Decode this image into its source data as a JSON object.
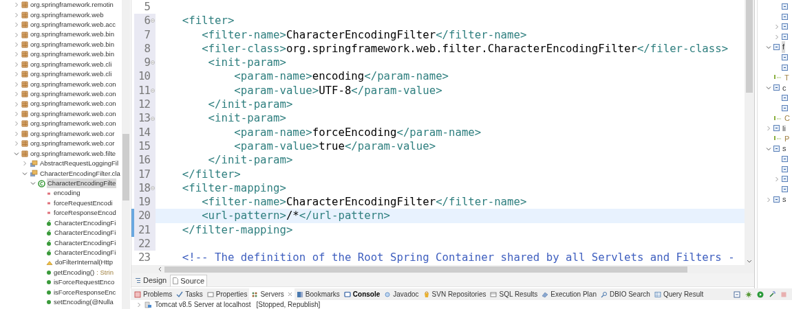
{
  "package_explorer": {
    "items": [
      {
        "name": "org.springframework.remotin",
        "kind": "package",
        "expanded": false,
        "selected": false
      },
      {
        "name": "org.springframework.web",
        "kind": "package",
        "expanded": false,
        "selected": false
      },
      {
        "name": "org.springframework.web.acc",
        "kind": "package",
        "expanded": false,
        "selected": false
      },
      {
        "name": "org.springframework.web.bin",
        "kind": "package",
        "expanded": false,
        "selected": false
      },
      {
        "name": "org.springframework.web.bin",
        "kind": "package",
        "expanded": false,
        "selected": false
      },
      {
        "name": "org.springframework.web.bin",
        "kind": "package",
        "expanded": false,
        "selected": false
      },
      {
        "name": "org.springframework.web.cli",
        "kind": "package",
        "expanded": false,
        "selected": false
      },
      {
        "name": "org.springframework.web.cli",
        "kind": "package",
        "expanded": false,
        "selected": false
      },
      {
        "name": "org.springframework.web.con",
        "kind": "package",
        "expanded": false,
        "selected": false
      },
      {
        "name": "org.springframework.web.con",
        "kind": "package",
        "expanded": false,
        "selected": false
      },
      {
        "name": "org.springframework.web.con",
        "kind": "package",
        "expanded": false,
        "selected": false
      },
      {
        "name": "org.springframework.web.con",
        "kind": "package",
        "expanded": false,
        "selected": false
      },
      {
        "name": "org.springframework.web.con",
        "kind": "package",
        "expanded": false,
        "selected": false
      },
      {
        "name": "org.springframework.web.cor",
        "kind": "package",
        "expanded": false,
        "selected": false
      },
      {
        "name": "org.springframework.web.cor",
        "kind": "package",
        "expanded": false,
        "selected": false
      },
      {
        "name": "org.springframework.web.filte",
        "kind": "package",
        "expanded": true,
        "selected": false,
        "children": [
          {
            "name": "AbstractRequestLoggingFil",
            "kind": "classfile",
            "expanded": false,
            "selected": false
          },
          {
            "name": "CharacterEncodingFilter.cla",
            "kind": "classfile",
            "expanded": true,
            "selected": false,
            "children": [
              {
                "name": "CharacterEncodingFilte",
                "kind": "class",
                "expanded": true,
                "selected": true,
                "children": [
                  {
                    "name": "encoding",
                    "kind": "field",
                    "selected": false
                  },
                  {
                    "name": "forceRequestEncodi",
                    "kind": "field",
                    "selected": false
                  },
                  {
                    "name": "forceResponseEncod",
                    "kind": "field",
                    "selected": false
                  },
                  {
                    "name": "CharacterEncodingFi",
                    "kind": "constructor",
                    "selected": false
                  },
                  {
                    "name": "CharacterEncodingFi",
                    "kind": "constructor",
                    "selected": false
                  },
                  {
                    "name": "CharacterEncodingFi",
                    "kind": "constructor",
                    "selected": false
                  },
                  {
                    "name": "CharacterEncodingFi",
                    "kind": "constructor",
                    "selected": false
                  },
                  {
                    "name": "doFilterInternal(Http",
                    "kind": "protected_method",
                    "selected": false
                  },
                  {
                    "name": "getEncoding()",
                    "type": ": Strin",
                    "kind": "method",
                    "selected": false
                  },
                  {
                    "name": "isForceRequestEnco",
                    "kind": "method",
                    "selected": false
                  },
                  {
                    "name": "isForceResponseEnc",
                    "kind": "method",
                    "selected": false
                  },
                  {
                    "name": "setEncoding(@Nulla",
                    "kind": "method",
                    "selected": false
                  }
                ]
              }
            ]
          }
        ]
      }
    ]
  },
  "editor": {
    "lines": [
      {
        "number": "5",
        "foldable": false,
        "current": false,
        "changed": false,
        "shaded": false
      },
      {
        "number": "6",
        "text": "    <filter>",
        "foldable": true,
        "current": false,
        "changed": false,
        "shaded": true
      },
      {
        "number": "7",
        "text": "       <filter-name>CharacterEncodingFilter</filter-name>",
        "foldable": false,
        "current": false,
        "changed": false,
        "shaded": true
      },
      {
        "number": "8",
        "text": "       <filer-class>org.springframework.web.filter.CharacterEncodingFilter</filer-class>",
        "foldable": false,
        "current": false,
        "changed": false,
        "shaded": true
      },
      {
        "number": "9",
        "text": "        <init-param>",
        "foldable": true,
        "current": false,
        "changed": false,
        "shaded": true
      },
      {
        "number": "10",
        "text": "            <param-name>encoding</param-name>",
        "foldable": false,
        "current": false,
        "changed": false,
        "shaded": true
      },
      {
        "number": "11",
        "text": "            <param-value>UTF-8</param-value>",
        "foldable": true,
        "current": false,
        "changed": false,
        "shaded": true
      },
      {
        "number": "12",
        "text": "        </init-param>",
        "foldable": false,
        "current": false,
        "changed": false,
        "shaded": true
      },
      {
        "number": "13",
        "text": "        <init-param>",
        "foldable": true,
        "current": false,
        "changed": false,
        "shaded": true
      },
      {
        "number": "14",
        "text": "            <param-name>forceEncoding</param-name>",
        "foldable": false,
        "current": false,
        "changed": false,
        "shaded": true
      },
      {
        "number": "15",
        "text": "            <param-value>true</param-value>",
        "foldable": false,
        "current": false,
        "changed": false,
        "shaded": true
      },
      {
        "number": "16",
        "text": "        </init-param>",
        "foldable": false,
        "current": false,
        "changed": false,
        "shaded": true
      },
      {
        "number": "17",
        "text": "    </filter>",
        "foldable": false,
        "current": false,
        "changed": false,
        "shaded": true
      },
      {
        "number": "18",
        "text": "    <filter-mapping>",
        "foldable": true,
        "current": false,
        "changed": false,
        "shaded": true
      },
      {
        "number": "19",
        "text": "       <filter-name>CharacterEncodingFilter</filter-name>",
        "foldable": false,
        "current": false,
        "changed": false,
        "shaded": true
      },
      {
        "number": "20",
        "text": "       <url-pattern>/*</url-pattern>",
        "foldable": false,
        "current": true,
        "changed": true,
        "shaded": true
      },
      {
        "number": "21",
        "text": "    </filter-mapping>",
        "foldable": false,
        "current": false,
        "changed": true,
        "shaded": true
      },
      {
        "number": "22",
        "foldable": false,
        "current": false,
        "changed": false,
        "shaded": true
      },
      {
        "number": "23",
        "text": "    <!-- The definition of the Root Spring Container shared by all Servlets and Filters -",
        "foldable": false,
        "current": false,
        "changed": false,
        "shaded": false
      }
    ]
  },
  "editor_tabs": [
    {
      "label": "Design",
      "selected": false
    },
    {
      "label": "Source",
      "selected": true
    }
  ],
  "views": {
    "tabs": [
      {
        "label": "Problems",
        "selected": false,
        "bold": false
      },
      {
        "label": "Tasks",
        "selected": false,
        "bold": false
      },
      {
        "label": "Properties",
        "selected": false,
        "bold": false
      },
      {
        "label": "Servers",
        "selected": true,
        "bold": false
      },
      {
        "label": "Bookmarks",
        "selected": false,
        "bold": false
      },
      {
        "label": "Console",
        "selected": false,
        "bold": true
      },
      {
        "label": "Javadoc",
        "selected": false,
        "bold": false
      },
      {
        "label": "SVN Repositories",
        "selected": false,
        "bold": false
      },
      {
        "label": "SQL Results",
        "selected": false,
        "bold": false
      },
      {
        "label": "Execution Plan",
        "selected": false,
        "bold": false
      },
      {
        "label": "DBIO Search",
        "selected": false,
        "bold": false
      },
      {
        "label": "Query Result",
        "selected": false,
        "bold": false
      }
    ],
    "servers": [
      {
        "name": "Tomcat v8.5 Server at localhost",
        "state": "[Stopped, Republish]",
        "expanded": false
      }
    ]
  },
  "outline": {
    "continued_children": [
      {
        "kind": "element"
      },
      {
        "kind": "element"
      },
      {
        "kind": "element",
        "expanded": false
      },
      {
        "kind": "element",
        "expanded": false
      }
    ],
    "items": [
      {
        "kind": "element",
        "text": "f",
        "expanded": true,
        "selected": true,
        "children": [
          {
            "kind": "element"
          },
          {
            "kind": "element"
          }
        ]
      },
      {
        "kind": "comment",
        "text": "T",
        "selected": false
      },
      {
        "kind": "element",
        "text": "c",
        "expanded": true,
        "selected": false,
        "children": [
          {
            "kind": "element"
          },
          {
            "kind": "element"
          }
        ]
      },
      {
        "kind": "comment",
        "text": "C",
        "selected": false
      },
      {
        "kind": "element",
        "text": "li",
        "expanded": false,
        "selected": false
      },
      {
        "kind": "comment",
        "text": "P",
        "selected": false
      },
      {
        "kind": "element",
        "text": "s",
        "expanded": true,
        "selected": false,
        "children": [
          {
            "kind": "element"
          },
          {
            "kind": "element"
          },
          {
            "kind": "element",
            "expanded": false
          },
          {
            "kind": "element"
          }
        ]
      },
      {
        "kind": "element",
        "text": "s",
        "expanded": false,
        "selected": false
      }
    ]
  }
}
